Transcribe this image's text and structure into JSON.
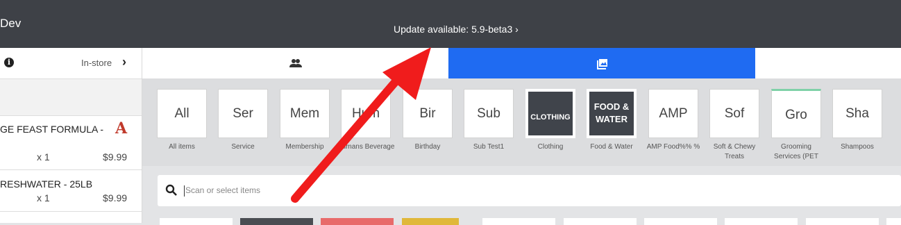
{
  "topbar": {
    "app_name": "Dev",
    "update_text": "Update available: 5.9-beta3 ›"
  },
  "left_panel": {
    "store_mode": "In-store",
    "cart": [
      {
        "name": "GE FEAST FORMULA -",
        "qty": "x 1",
        "price": "$9.99",
        "badge": "A"
      },
      {
        "name": "RESHWATER - 25LB",
        "qty": "x 1",
        "price": "$9.99"
      }
    ]
  },
  "tabs": [
    {
      "icon": "people-icon",
      "active": false
    },
    {
      "icon": "image-gallery-icon",
      "active": true
    },
    {
      "icon": "",
      "active": false
    }
  ],
  "categories": [
    {
      "tile": "All",
      "caption": "All items"
    },
    {
      "tile": "Ser",
      "caption": "Service"
    },
    {
      "tile": "Mem",
      "caption": "Membership"
    },
    {
      "tile": "Hum",
      "caption": "Humans Beverage"
    },
    {
      "tile": "Bir",
      "caption": "Birthday"
    },
    {
      "tile": "Sub",
      "caption": "Sub Test1"
    },
    {
      "tile": "CLOTHING",
      "caption": "Clothing",
      "dark": true
    },
    {
      "tile": "FOOD & WATER",
      "caption": "Food & Water",
      "dark": true
    },
    {
      "tile": "AMP",
      "caption": "AMP Food%% %"
    },
    {
      "tile": "Sof",
      "caption": "Soft & Chewy Treats"
    },
    {
      "tile": "Gro",
      "caption": "Grooming Services (PET"
    },
    {
      "tile": "Sha",
      "caption": "Shampoos"
    }
  ],
  "search": {
    "placeholder": "Scan or select items"
  },
  "colors": {
    "topbar": "#3e4147",
    "active_tab": "#1f6bf2",
    "arrow": "#f01c1c",
    "badge": "#c0392b"
  }
}
